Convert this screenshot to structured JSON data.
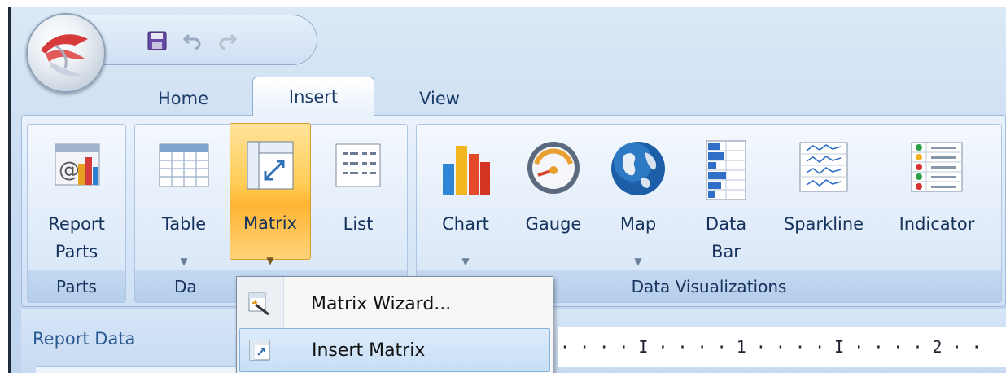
{
  "tabs": [
    {
      "label": "Home"
    },
    {
      "label": "Insert"
    },
    {
      "label": "View"
    }
  ],
  "ribbon": {
    "groups": [
      {
        "label": "Parts"
      },
      {
        "label": "Da"
      },
      {
        "label": "Data Visualizations"
      }
    ],
    "buttons": {
      "report_parts": {
        "line1": "Report",
        "line2": "Parts"
      },
      "table": "Table",
      "matrix": "Matrix",
      "list": "List",
      "chart": "Chart",
      "gauge": "Gauge",
      "map": "Map",
      "data_bar": {
        "line1": "Data",
        "line2": "Bar"
      },
      "sparkline": "Sparkline",
      "indicator": "Indicator"
    }
  },
  "menu": {
    "items": [
      {
        "label": "Matrix Wizard..."
      },
      {
        "label": "Insert Matrix"
      }
    ]
  },
  "report_data": {
    "label": "Report Data"
  },
  "ruler": {
    "text": "· · · · I · · · · 1 · · · · I · · · · 2 · ·"
  },
  "icons": [
    "app-logo-icon",
    "save-icon",
    "undo-icon",
    "redo-icon",
    "report-parts-icon",
    "table-icon",
    "matrix-icon",
    "list-icon",
    "chart-icon",
    "gauge-icon",
    "map-icon",
    "data-bar-icon",
    "sparkline-icon",
    "indicator-icon",
    "matrix-wizard-icon",
    "insert-matrix-icon"
  ],
  "colors": {
    "accent_hover": "#ffcc55",
    "text": "#15325c",
    "ribbon": "#dbe8f8"
  }
}
